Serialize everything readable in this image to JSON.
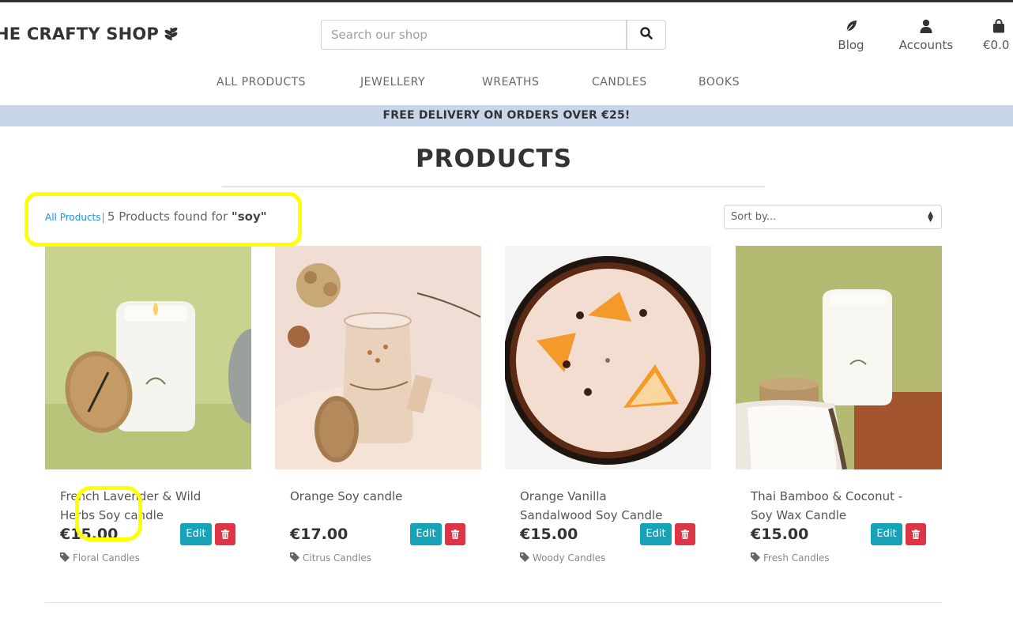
{
  "header": {
    "logo_text": "HE CRAFTY SHOP",
    "search_placeholder": "Search our shop",
    "blog_label": "Blog",
    "accounts_label": "Accounts",
    "bag_total": "€0.0"
  },
  "nav": {
    "items": [
      "ALL PRODUCTS",
      "JEWELLERY",
      "WREATHS",
      "CANDLES",
      "BOOKS"
    ]
  },
  "banner": {
    "text": "FREE DELIVERY ON ORDERS OVER €25!"
  },
  "page": {
    "title": "PRODUCTS",
    "all_products_link": "All Products",
    "separator": "|",
    "results_prefix": "5 Products found for",
    "search_term": "\"soy\"",
    "sort_label": "Sort by..."
  },
  "products": [
    {
      "name": "French Lavender & Wild Herbs Soy candle",
      "price": "€15.00",
      "category": "Floral Candles",
      "edit_label": "Edit"
    },
    {
      "name": "Orange Soy candle",
      "price": "€17.00",
      "category": "Citrus Candles",
      "edit_label": "Edit"
    },
    {
      "name": "Orange Vanilla Sandalwood Soy Candle",
      "price": "€15.00",
      "category": "Woody Candles",
      "edit_label": "Edit"
    },
    {
      "name": "Thai Bamboo & Coconut - Soy Wax Candle",
      "price": "€15.00",
      "category": "Fresh Candles",
      "edit_label": "Edit"
    }
  ],
  "colors": {
    "banner_bg": "#c8d6ec",
    "edit_button": "#17a2b8",
    "delete_button": "#dc3545",
    "highlight": "#ffff00",
    "link": "#1f8fe0"
  },
  "icons": {
    "logo": "leaf-icon",
    "search": "search-icon",
    "blog": "feather-icon",
    "accounts": "user-icon",
    "bag": "shopping-bag-icon",
    "sort": "sort-caret-icon",
    "delete": "trash-icon",
    "category": "tag-icon"
  }
}
